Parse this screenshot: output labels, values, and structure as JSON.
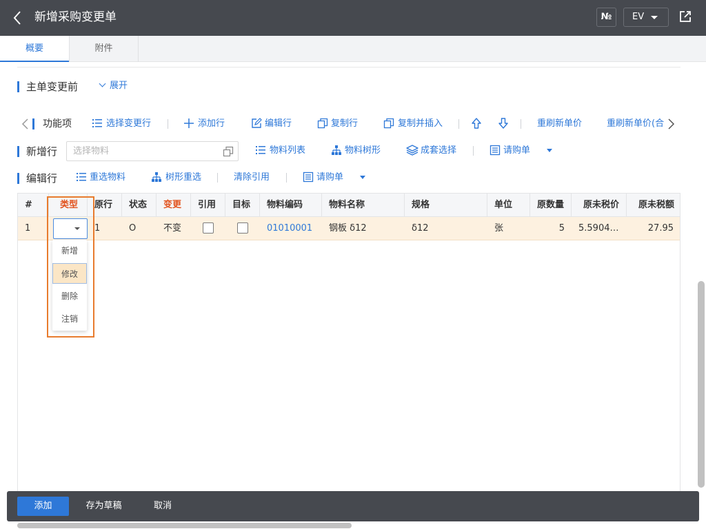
{
  "header": {
    "title": "新增采购变更单",
    "no_button": "№",
    "ev_button": "EV"
  },
  "tabs": [
    {
      "label": "概要"
    },
    {
      "label": "附件"
    }
  ],
  "master_section": {
    "title": "主单变更前",
    "expand_label": "展开"
  },
  "function_bar": {
    "label": "功能项",
    "items": [
      "选择变更行",
      "添加行",
      "编辑行",
      "复制行",
      "复制并插入",
      "重刷新单价",
      "重刷新单价(合"
    ]
  },
  "add_row_bar": {
    "label": "新增行",
    "input_placeholder": "选择物料",
    "items": [
      "物料列表",
      "物料树形",
      "成套选择",
      "请购单"
    ]
  },
  "edit_row_bar": {
    "label": "编辑行",
    "items": [
      "重选物料",
      "树形重选",
      "清除引用",
      "请购单"
    ]
  },
  "table": {
    "columns": [
      "#",
      "类型",
      "原行",
      "状态",
      "变更",
      "引用",
      "目标",
      "物料编码",
      "物料名称",
      "规格",
      "单位",
      "原数量",
      "原未税价",
      "原未税额"
    ],
    "rows": [
      {
        "num": "1",
        "type": "",
        "orig_row": "1",
        "status": "O",
        "change": "不变",
        "ref_checked": false,
        "target_checked": false,
        "material_code": "01010001",
        "material_name": "钢板 δ12",
        "spec": "δ12",
        "unit": "张",
        "orig_qty": "5",
        "orig_price": "5.5904…",
        "orig_amount": "27.95"
      }
    ]
  },
  "type_dropdown": {
    "options": [
      "新增",
      "修改",
      "删除",
      "注销"
    ],
    "selected": "修改"
  },
  "footer": {
    "add": "添加",
    "save_draft": "存为草稿",
    "cancel": "取消"
  },
  "colors": {
    "header_bg": "#46494f",
    "accent": "#2e78d8",
    "change_red": "#e2541f",
    "row_highlight": "#fdf1e0",
    "annotation_orange": "#e87b2d"
  }
}
